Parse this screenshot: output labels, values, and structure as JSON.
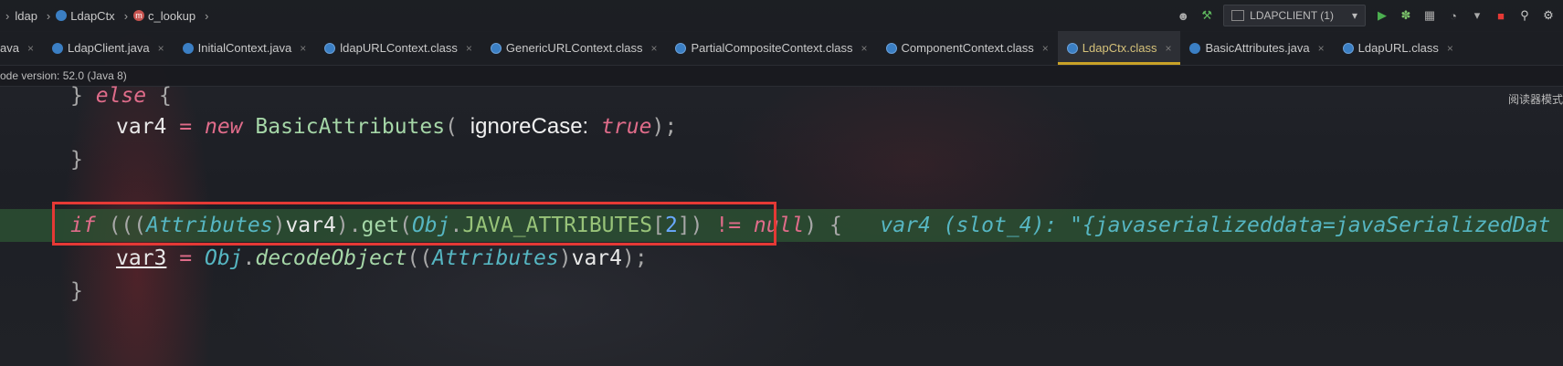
{
  "breadcrumb": {
    "items": [
      "ldap",
      "LdapCtx",
      "c_lookup"
    ]
  },
  "toolbar": {
    "run_config": "LDAPCLIENT (1)"
  },
  "tabs": [
    {
      "label": "ava",
      "icon": "none"
    },
    {
      "label": "LdapClient.java",
      "icon": "class-icon"
    },
    {
      "label": "InitialContext.java",
      "icon": "class-icon"
    },
    {
      "label": "ldapURLContext.class",
      "icon": "class-icon"
    },
    {
      "label": "GenericURLContext.class",
      "icon": "class-icon"
    },
    {
      "label": "PartialCompositeContext.class",
      "icon": "class-icon"
    },
    {
      "label": "ComponentContext.class",
      "icon": "class-icon"
    },
    {
      "label": "LdapCtx.class",
      "icon": "class-icon",
      "active": true
    },
    {
      "label": "BasicAttributes.java",
      "icon": "class-icon"
    },
    {
      "label": "LdapURL.class",
      "icon": "class-icon"
    }
  ],
  "info": {
    "bytecode": "ode version: 52.0 (Java 8)"
  },
  "reader_mode": "阅读器模式",
  "code": {
    "l1_else": "else",
    "l1_open": "{",
    "l1_close": "}",
    "l2_var": "var4",
    "l2_eq": "=",
    "l2_new": "new",
    "l2_fn": "BasicAttributes",
    "l2_hint": "ignoreCase:",
    "l2_val": "true",
    "l3_close": "}",
    "l5_if": "if",
    "l5_type": "Attributes",
    "l5_var": "var4",
    "l5_get": "get",
    "l5_obj": "Obj",
    "l5_const": "JAVA_ATTRIBUTES",
    "l5_idx": "2",
    "l5_neq": "!=",
    "l5_null": "null",
    "l5_debug": "var4 (slot_4): \"{javaserializeddata=javaSerializedDat",
    "l6_var": "var3",
    "l6_eq": "=",
    "l6_obj": "Obj",
    "l6_fn": "decodeObject",
    "l6_type": "Attributes",
    "l6_arg": "var4",
    "l7_close": "}"
  }
}
